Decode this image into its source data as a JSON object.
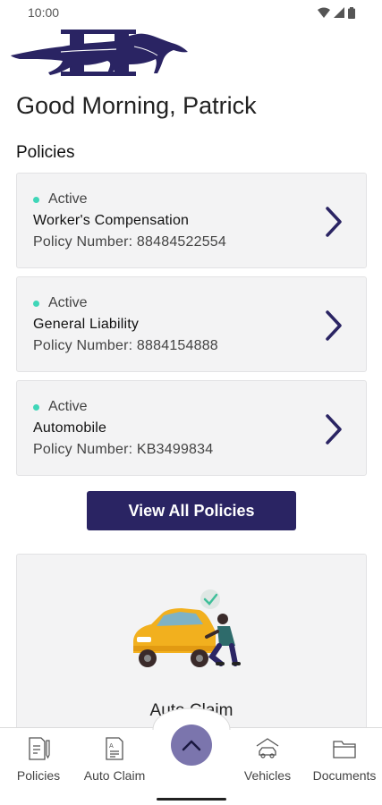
{
  "status_bar": {
    "time": "10:00"
  },
  "greeting": "Good Morning, Patrick",
  "policies_section": {
    "title": "Policies",
    "items": [
      {
        "status": "Active",
        "name": "Worker's Compensation",
        "number": "Policy Number: 88484522554"
      },
      {
        "status": "Active",
        "name": "General Liability",
        "number": "Policy Number: 8884154888"
      },
      {
        "status": "Active",
        "name": "Automobile",
        "number": "Policy Number: KB3499834"
      }
    ],
    "view_all_label": "View All Policies"
  },
  "claim_card": {
    "title": "Auto Claim"
  },
  "bottom_nav": {
    "items": [
      {
        "label": "Policies",
        "icon": "document-pen-icon"
      },
      {
        "label": "Auto Claim",
        "icon": "claim-form-icon"
      },
      {
        "label": "Vehicles",
        "icon": "car-garage-icon"
      },
      {
        "label": "Documents",
        "icon": "folder-icon"
      }
    ],
    "center_icon": "chevron-up-icon"
  },
  "colors": {
    "primary": "#2a2463",
    "active_dot": "#3fd6b8",
    "card_bg": "#f3f3f4",
    "center_button": "#7b75ad"
  }
}
